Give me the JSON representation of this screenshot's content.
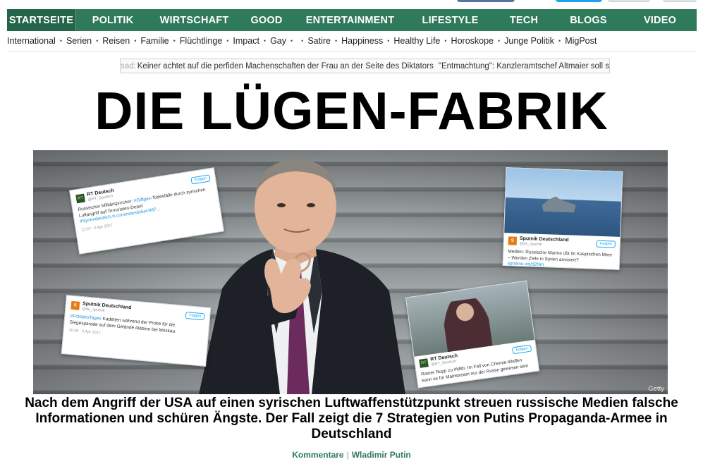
{
  "nav": {
    "items": [
      "STARTSEITE",
      "POLITIK",
      "WIRTSCHAFT",
      "GOOD",
      "ENTERTAINMENT",
      "LIFESTYLE",
      "TECH",
      "BLOGS",
      "VIDEO"
    ],
    "accent": "#2f7a5b"
  },
  "subnav": {
    "items": [
      "International",
      "Serien",
      "Reisen",
      "Familie",
      "Flüchtlinge",
      "Impact",
      "Gay",
      "",
      "Satire",
      "Happiness",
      "Healthy Life",
      "Horoskope",
      "Junge Politik",
      "MigPost"
    ]
  },
  "ticker": {
    "fade": "sad: ",
    "item1": "Keiner achtet auf die perfiden Machenschaften der Frau an der Seite des Diktators",
    "item2": "\"Entmachtung\": Kanzleramtschef Altmaier soll s"
  },
  "article": {
    "headline": "DIE LÜGEN-FABRIK",
    "teaser": "Nach dem Angriff der USA auf einen syrischen Luftwaffenstützpunkt streuen russische Medien falsche Informationen und schüren Ängste. Der Fall zeigt die 7 Strategien von Putins Propaganda-Armee in Deutschland",
    "credit": "Getty",
    "comments_label": "Kommentare",
    "tag_label": "Wladimir Putin"
  },
  "tweets": {
    "t1": {
      "logo": "RT",
      "name": "RT Deutsch",
      "handle": "@RT_Deutsch",
      "follow": "Folgen",
      "body_a": "Russischer Militärsprecher: ",
      "body_link": "#Giftgas",
      "body_b": "-Todesfälle durch syrischen Luftangriff auf Terroristen-Depot",
      "body_url": "#Syriendeutsch.rt.com/newsticker/487...",
      "meta": "12:07 - 5 Apr 2017"
    },
    "t2": {
      "logo": "S",
      "name": "Sputnik Deutschland",
      "handle": "@de_sputnik",
      "follow": "Folgen",
      "body": "Medien: Russische Marine übt im Kaspischen Meer – Werden Ziele in Syrien anvisiert?",
      "body_link": "sptnkne.ws/d2Nm"
    },
    "t3": {
      "logo": "S",
      "name": "Sputnik Deutschland",
      "handle": "@de_sputnik",
      "follow": "Folgen",
      "body_link": "#FotodesTages",
      "body": " Kadetten während der Probe für die Siegesparade auf dem Gelände Alabino bei Moskau",
      "meta": "20:00 - 5 Apr 2017"
    },
    "t4": {
      "logo": "RT",
      "name": "RT Deutsch",
      "handle": "@RT_Deutsch",
      "follow": "Folgen",
      "body": "Rainer Rupp zu #Idlib: Im Fall von Chemie-Waffen kann es für Mainstream nur der Russe gewesen sein"
    }
  }
}
